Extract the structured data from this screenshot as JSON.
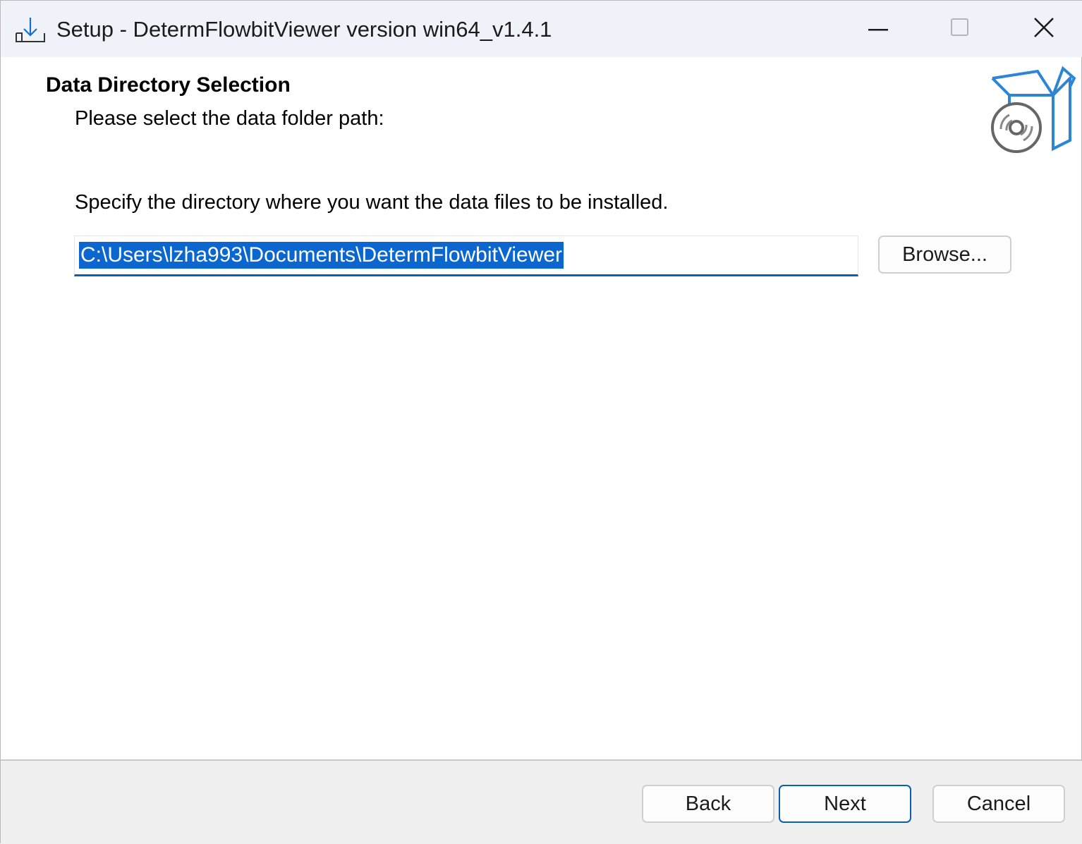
{
  "window": {
    "title": "Setup - DetermFlowbitViewer version win64_v1.4.1",
    "controls": {
      "minimize_icon": "minimize-icon",
      "maximize_icon": "maximize-icon",
      "close_icon": "close-icon"
    }
  },
  "header": {
    "heading": "Data Directory Selection",
    "subheading": "Please select the data folder path:",
    "graphic_icon": "setup-box-disc-icon"
  },
  "main": {
    "instruction": "Specify the directory where you want the data files to be installed.",
    "path_value": "C:\\Users\\lzha993\\Documents\\DetermFlowbitViewer",
    "browse_label": "Browse..."
  },
  "footer": {
    "back_label": "Back",
    "next_label": "Next",
    "cancel_label": "Cancel"
  },
  "colors": {
    "accent": "#0a5fb0",
    "selection": "#0b67cf",
    "titlebar": "#eff3f9",
    "footer": "#f0f0f0"
  }
}
